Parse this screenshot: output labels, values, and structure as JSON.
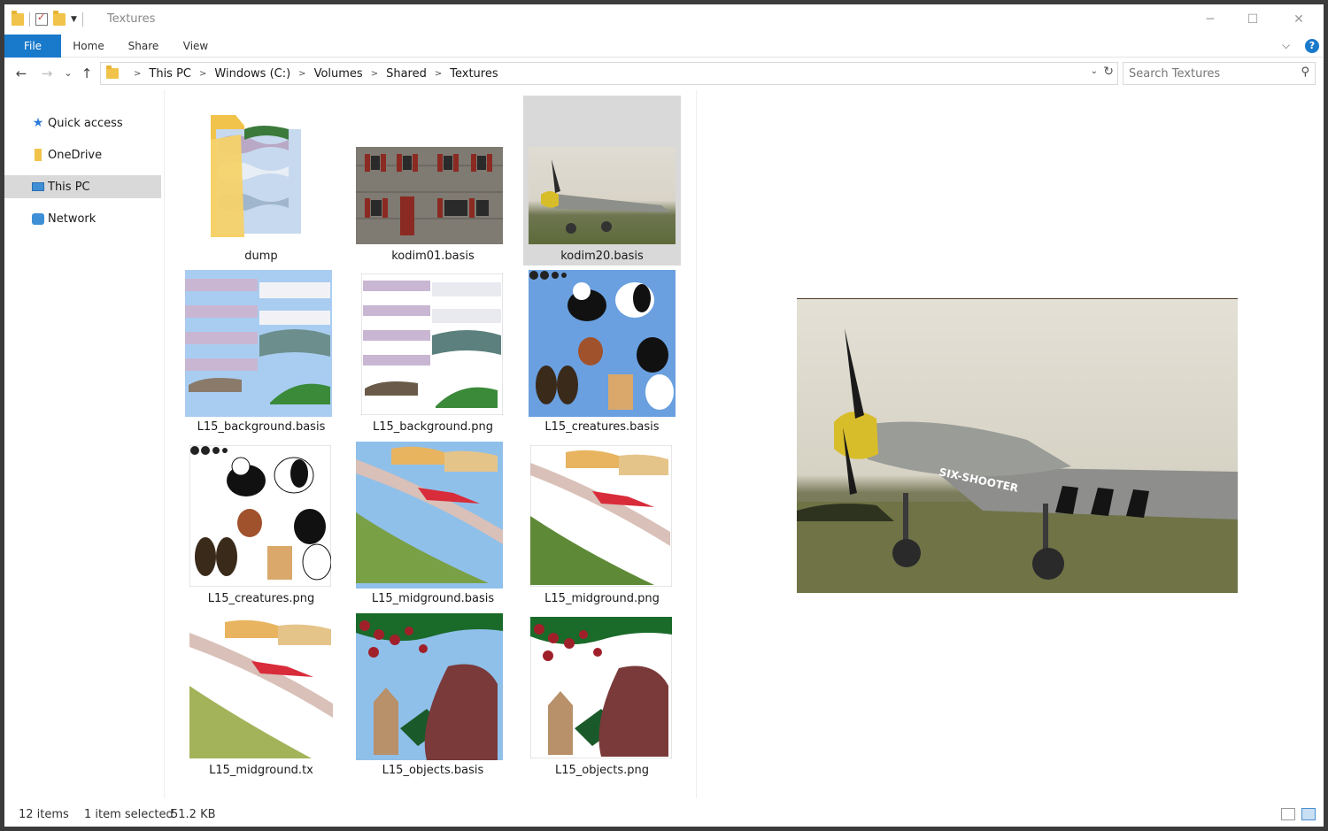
{
  "window": {
    "title": "Textures"
  },
  "titlebar": {
    "minimize": "─",
    "maximize": "☐",
    "close": "✕"
  },
  "ribbon": {
    "tabs": [
      "File",
      "Home",
      "Share",
      "View"
    ],
    "help": "?"
  },
  "nav": {
    "back": "←",
    "forward": "→",
    "recent": "⌄",
    "up": "↑"
  },
  "address": {
    "crumbs": [
      "This PC",
      "Windows (C:)",
      "Volumes",
      "Shared",
      "Textures"
    ],
    "refresh": "↻",
    "dropdown": "⌄"
  },
  "search": {
    "placeholder": "Search Textures"
  },
  "navpane": {
    "items": [
      {
        "label": "Quick access",
        "icon": "star-icon"
      },
      {
        "label": "OneDrive",
        "icon": "folder-icon"
      },
      {
        "label": "This PC",
        "icon": "computer-icon",
        "selected": true
      },
      {
        "label": "Network",
        "icon": "network-icon"
      }
    ]
  },
  "files": [
    {
      "name": "dump"
    },
    {
      "name": "kodim01.basis"
    },
    {
      "name": "kodim20.basis",
      "selected": true
    },
    {
      "name": "L15_background.basis"
    },
    {
      "name": "L15_background.png"
    },
    {
      "name": "L15_creatures.basis"
    },
    {
      "name": "L15_creatures.png"
    },
    {
      "name": "L15_midground.basis"
    },
    {
      "name": "L15_midground.png"
    },
    {
      "name": "L15_midground.tx"
    },
    {
      "name": "L15_objects.basis"
    },
    {
      "name": "L15_objects.png"
    }
  ],
  "status": {
    "count": "12 items",
    "selection": "1 item selected",
    "size": "51.2 KB"
  },
  "colors": {
    "accent": "#1979ca",
    "selection": "#d9d9d9"
  }
}
